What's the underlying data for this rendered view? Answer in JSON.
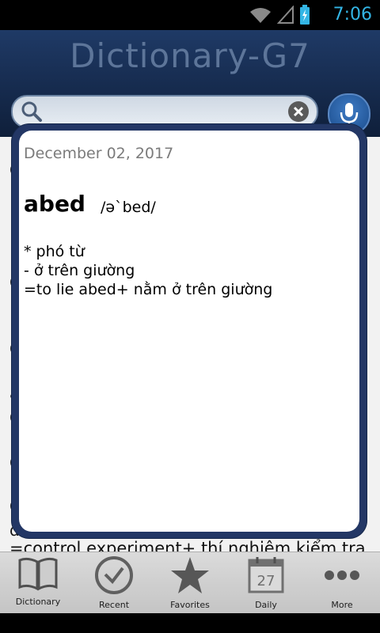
{
  "status_bar": {
    "time": "7:06"
  },
  "header": {
    "title": "Dictionary-G7",
    "search_placeholder": ""
  },
  "background_lines": [
    "C",
    "1",
    "=",
    "C",
    "1",
    "C",
    "a",
    "C",
    "1",
    "C",
    "1",
    "C",
    "d",
    "=control experiment+ thí nghiệm kiểm tra"
  ],
  "dialog": {
    "date": "December 02, 2017",
    "word": "abed",
    "phonetic": "/ə`bed/",
    "definitions": [
      "*  phó từ",
      "- ở trên giường",
      "=to lie abed+ nằm ở trên giường"
    ]
  },
  "bottom_nav": {
    "items": [
      {
        "label": "Dictionary",
        "icon": "book-icon"
      },
      {
        "label": "Recent",
        "icon": "check-circle-icon"
      },
      {
        "label": "Favorites",
        "icon": "star-icon"
      },
      {
        "label": "Daily",
        "icon": "calendar-icon",
        "badge": "27"
      },
      {
        "label": "More",
        "icon": "more-dots-icon"
      }
    ]
  },
  "colors": {
    "accent": "#33b5e5",
    "header": "#1f3a66",
    "dialog_frame": "#233765"
  }
}
